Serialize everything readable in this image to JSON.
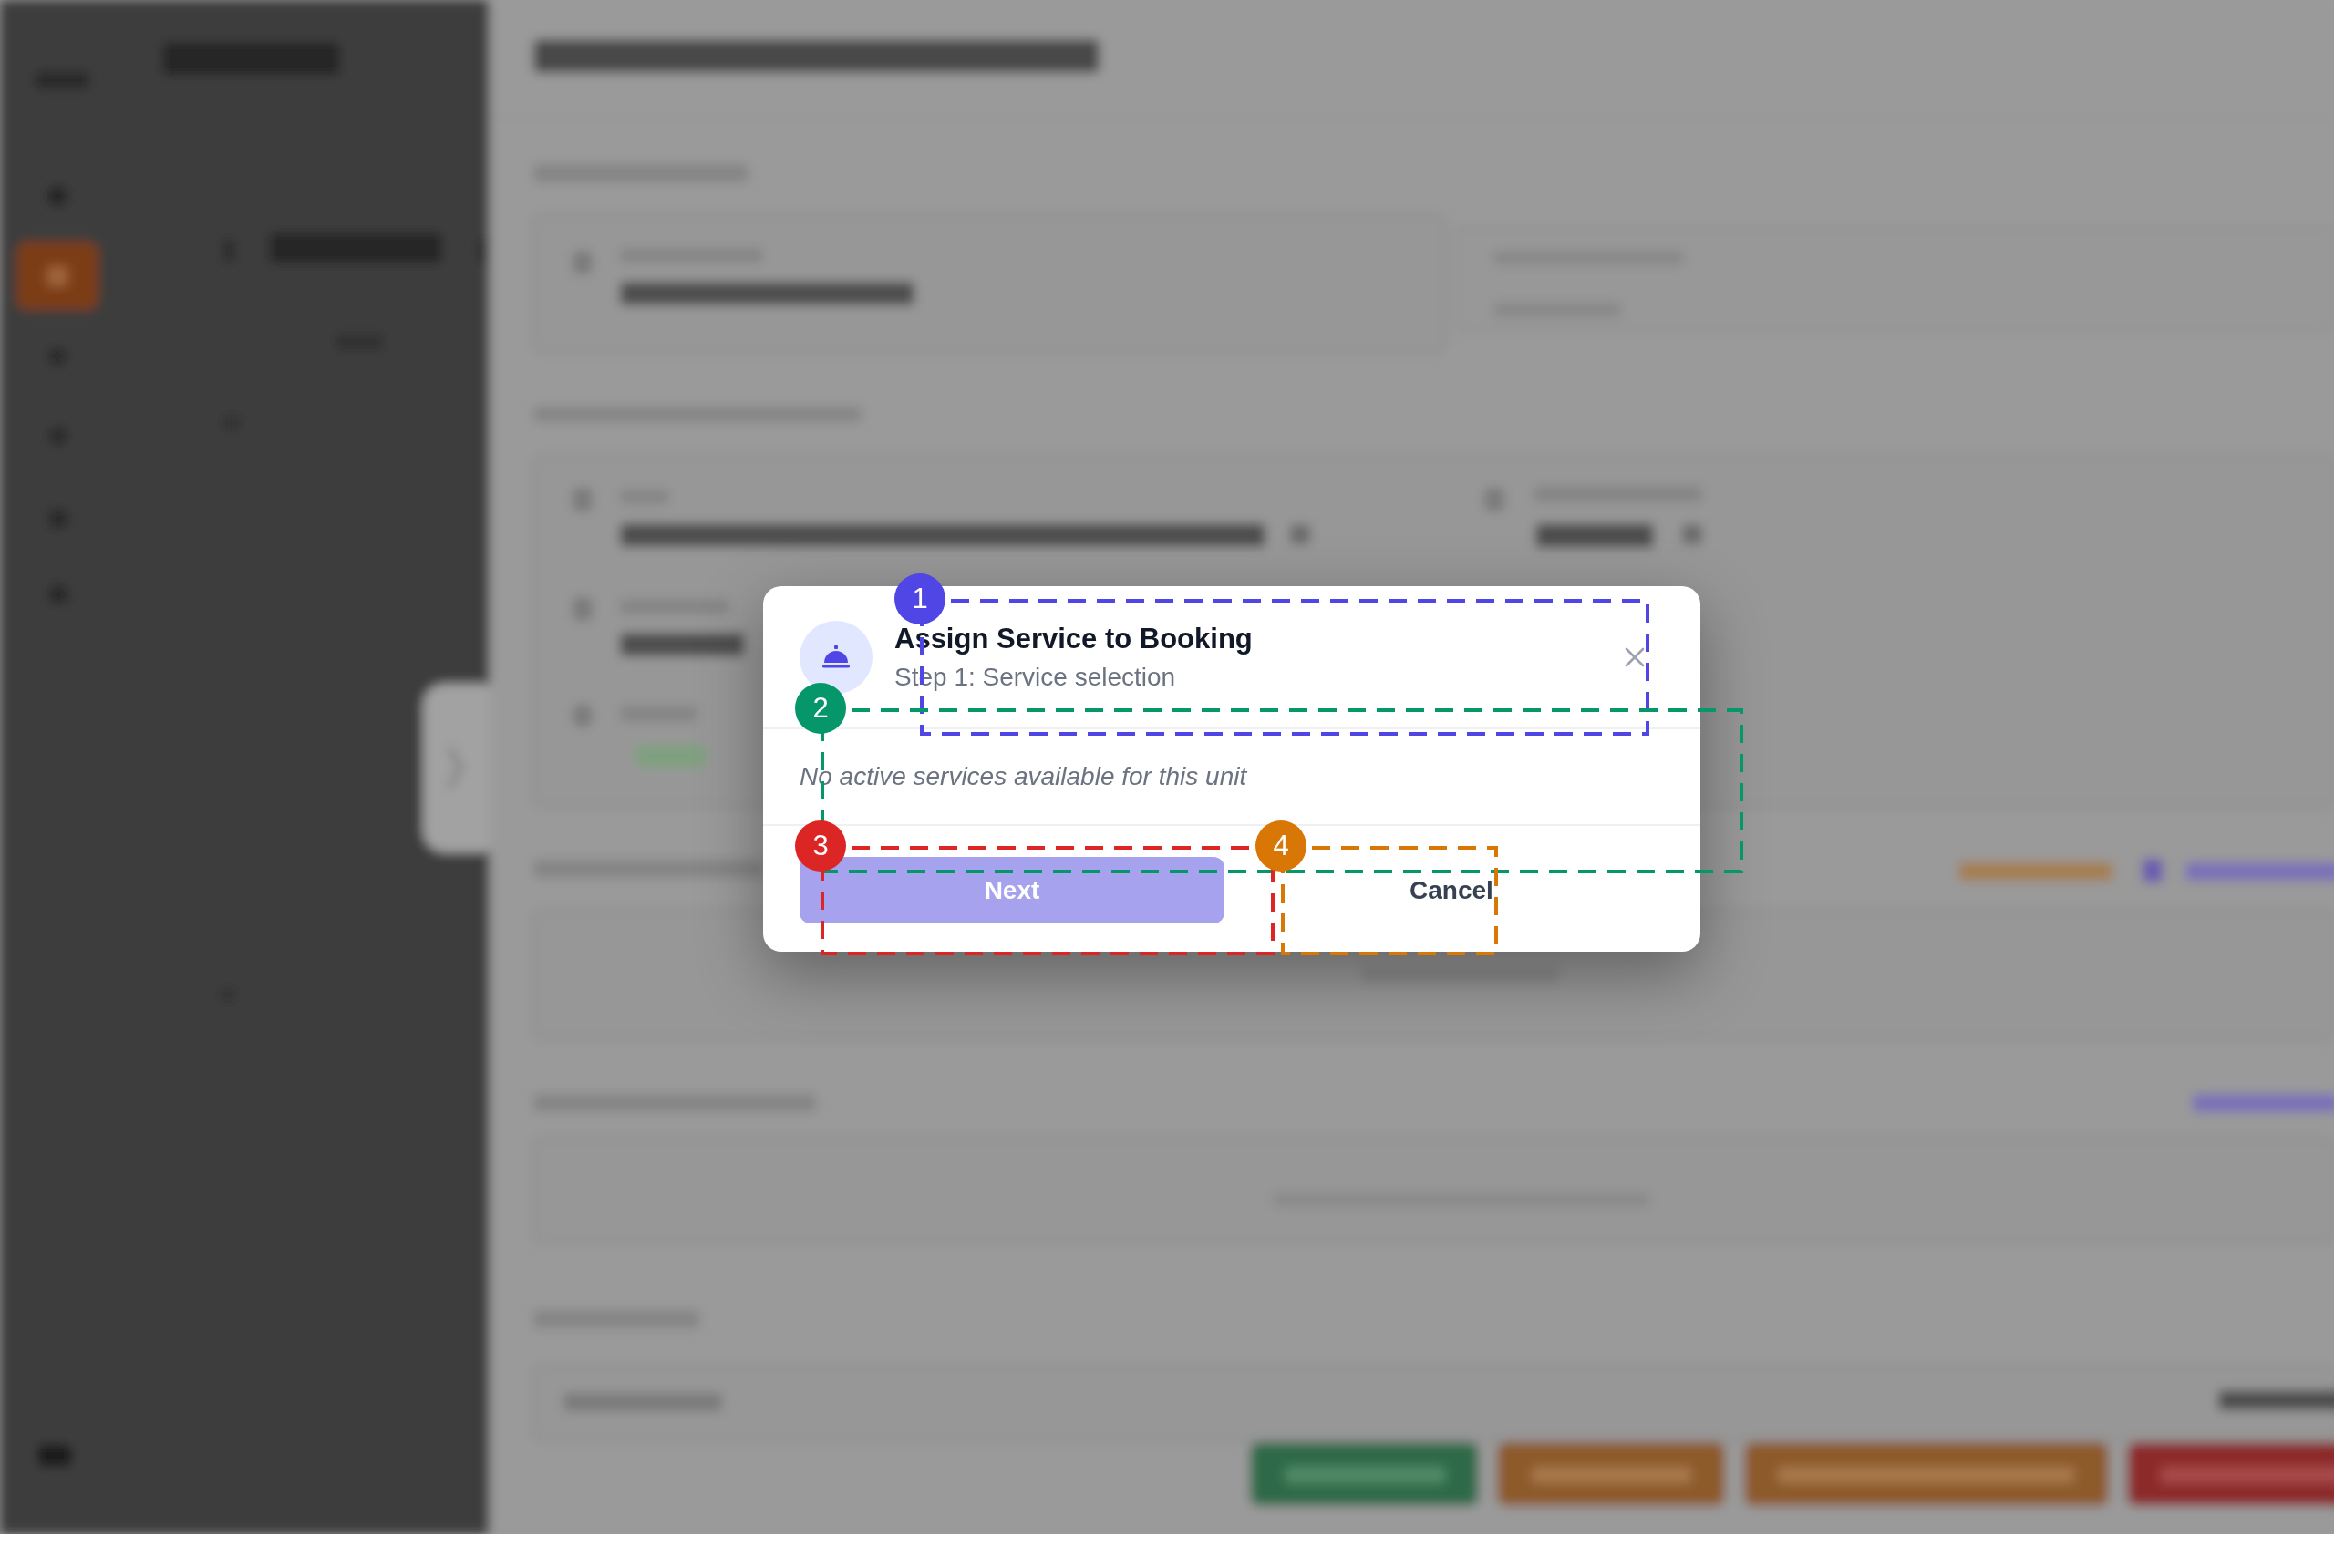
{
  "dialog": {
    "title": "Assign Service to Booking",
    "subtitle": "Step 1: Service selection",
    "message": "No active services available for this unit",
    "buttons": [
      {
        "label": "Next",
        "kind": "primary",
        "disabled": true
      },
      {
        "label": "Cancel",
        "kind": "secondary",
        "disabled": false
      }
    ]
  },
  "annotations": [
    {
      "label": "1",
      "color": "#4f46e5"
    },
    {
      "label": "2",
      "color": "#059669"
    },
    {
      "label": "3",
      "color": "#dc2626"
    },
    {
      "label": "4",
      "color": "#d97706"
    }
  ]
}
